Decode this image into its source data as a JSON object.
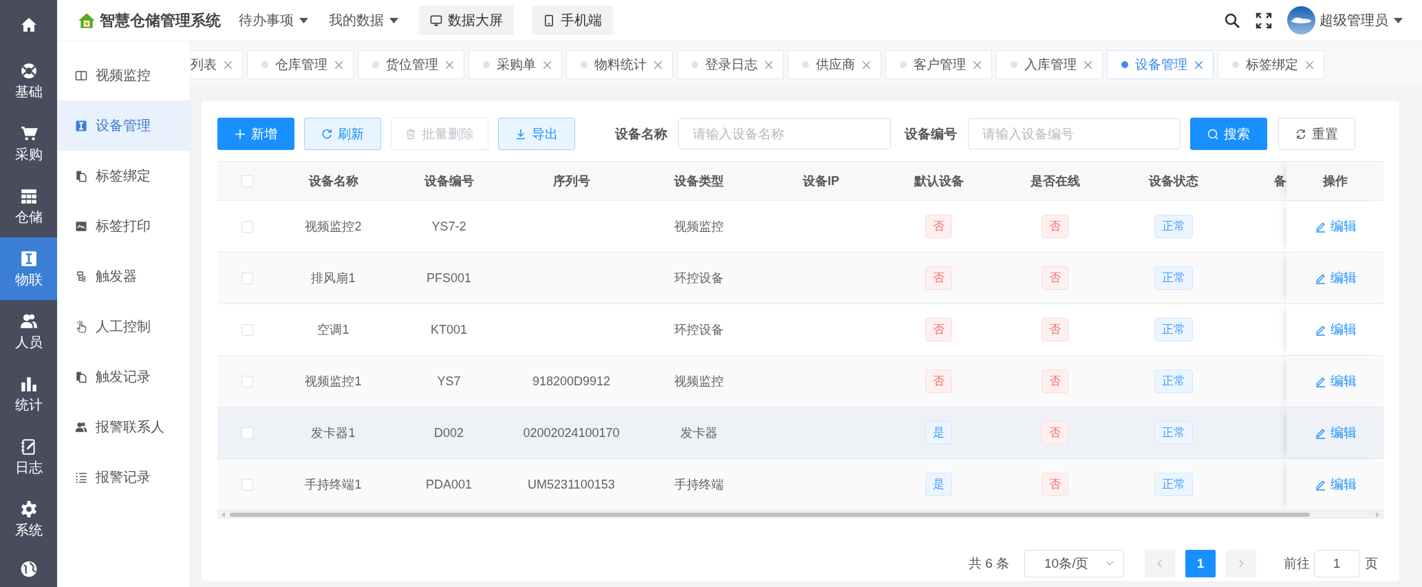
{
  "rail": {
    "items": [
      {
        "label": "基础",
        "selected": false
      },
      {
        "label": "采购",
        "selected": false
      },
      {
        "label": "仓储",
        "selected": false
      },
      {
        "label": "物联",
        "selected": true
      },
      {
        "label": "人员",
        "selected": false
      },
      {
        "label": "统计",
        "selected": false
      },
      {
        "label": "日志",
        "selected": false
      },
      {
        "label": "系统",
        "selected": false
      },
      {
        "selected": false
      }
    ]
  },
  "header": {
    "title": "智慧仓储管理系统",
    "menus": [
      {
        "label": "待办事项"
      },
      {
        "label": "我的数据"
      }
    ],
    "buttons": [
      {
        "label": "数据大屏"
      },
      {
        "label": "手机端"
      }
    ],
    "user": {
      "name": "超级管理员"
    }
  },
  "submenu": [
    {
      "label": "视频监控",
      "selected": false
    },
    {
      "label": "设备管理",
      "selected": true
    },
    {
      "label": "标签绑定",
      "selected": false
    },
    {
      "label": "标签打印",
      "selected": false
    },
    {
      "label": "触发器",
      "selected": false
    },
    {
      "label": "人工控制",
      "selected": false
    },
    {
      "label": "触发记录",
      "selected": false
    },
    {
      "label": "报警联系人",
      "selected": false
    },
    {
      "label": "报警记录",
      "selected": false
    }
  ],
  "tabs": [
    {
      "label": "列表",
      "selected": false,
      "cut": true
    },
    {
      "label": "仓库管理",
      "selected": false,
      "cut": false
    },
    {
      "label": "货位管理",
      "selected": false,
      "cut": false
    },
    {
      "label": "采购单",
      "selected": false,
      "cut": false
    },
    {
      "label": "物料统计",
      "selected": false,
      "cut": false
    },
    {
      "label": "登录日志",
      "selected": false,
      "cut": false
    },
    {
      "label": "供应商",
      "selected": false,
      "cut": false
    },
    {
      "label": "客户管理",
      "selected": false,
      "cut": false
    },
    {
      "label": "入库管理",
      "selected": false,
      "cut": false
    },
    {
      "label": "设备管理",
      "selected": true,
      "cut": false
    },
    {
      "label": "标签绑定",
      "selected": false,
      "cut": false
    }
  ],
  "toolbar": {
    "buttons": [
      {
        "label": "新增",
        "kind": "primary",
        "disabled": false
      },
      {
        "label": "刷新",
        "kind": "plain",
        "disabled": false
      },
      {
        "label": "批量删除",
        "kind": "delete",
        "disabled": true
      },
      {
        "label": "导出",
        "kind": "export",
        "disabled": false
      }
    ],
    "filters": [
      {
        "label": "设备名称",
        "placeholder": "请输入设备名称"
      },
      {
        "label": "设备编号",
        "placeholder": "请输入设备编号"
      }
    ],
    "search": "搜索",
    "reset": "重置"
  },
  "table": {
    "select_all": {
      "checked": false
    },
    "columns": [
      "设备名称",
      "设备编号",
      "序列号",
      "设备类型",
      "设备IP",
      "默认设备",
      "是否在线",
      "设备状态",
      "备"
    ],
    "action_column": "操作",
    "rows": [
      {
        "checked": false,
        "hovered": false,
        "name": "视频监控2",
        "code": "YS7-2",
        "type": "视频监控",
        "default": {
          "text": "否",
          "color": "#f56c6c"
        },
        "online": {
          "text": "否",
          "color": "#f56c6c"
        },
        "status": {
          "text": "正常",
          "color": "#409eff"
        },
        "action": "编辑"
      },
      {
        "checked": false,
        "hovered": false,
        "name": "排风扇1",
        "code": "PFS001",
        "type": "环控设备",
        "default": {
          "text": "否",
          "color": "#f56c6c"
        },
        "online": {
          "text": "否",
          "color": "#f56c6c"
        },
        "status": {
          "text": "正常",
          "color": "#409eff"
        },
        "action": "编辑"
      },
      {
        "checked": false,
        "hovered": false,
        "name": "空调1",
        "code": "KT001",
        "type": "环控设备",
        "default": {
          "text": "否",
          "color": "#f56c6c"
        },
        "online": {
          "text": "否",
          "color": "#f56c6c"
        },
        "status": {
          "text": "正常",
          "color": "#409eff"
        },
        "action": "编辑"
      },
      {
        "checked": false,
        "hovered": false,
        "name": "视频监控1",
        "code": "YS7",
        "serial": "918200D9912",
        "type": "视频监控",
        "default": {
          "text": "否",
          "color": "#f56c6c"
        },
        "online": {
          "text": "否",
          "color": "#f56c6c"
        },
        "status": {
          "text": "正常",
          "color": "#409eff"
        },
        "action": "编辑"
      },
      {
        "checked": false,
        "hovered": true,
        "name": "发卡器1",
        "code": "D002",
        "serial": "02002024100170",
        "type": "发卡器",
        "default": {
          "text": "是",
          "color": "#409eff"
        },
        "online": {
          "text": "否",
          "color": "#f56c6c"
        },
        "status": {
          "text": "正常",
          "color": "#409eff"
        },
        "action": "编辑"
      },
      {
        "checked": false,
        "hovered": false,
        "name": "手持终端1",
        "code": "PDA001",
        "serial": "UM5231100153",
        "type": "手持终端",
        "default": {
          "text": "是",
          "color": "#409eff"
        },
        "online": {
          "text": "否",
          "color": "#f56c6c"
        },
        "status": {
          "text": "正常",
          "color": "#409eff"
        },
        "action": "编辑"
      }
    ]
  },
  "pagination": {
    "total": "共 6 条",
    "page_size": "10条/页",
    "pages": [
      {
        "label": "1",
        "selected": true
      }
    ],
    "jump_label": "前往",
    "jump_value": "1",
    "jump_suffix": "页"
  }
}
